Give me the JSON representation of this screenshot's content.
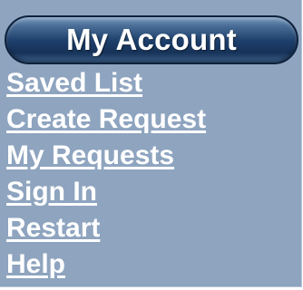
{
  "header": {
    "title": "My Account"
  },
  "menu": {
    "items": [
      {
        "label": "Saved List"
      },
      {
        "label": "Create Request"
      },
      {
        "label": "My Requests"
      },
      {
        "label": "Sign In"
      },
      {
        "label": "Restart"
      },
      {
        "label": "Help"
      }
    ]
  },
  "colors": {
    "panel_background": "#8ea4bf",
    "header_background": "#1d3f6b",
    "link_text": "#ffffff"
  }
}
